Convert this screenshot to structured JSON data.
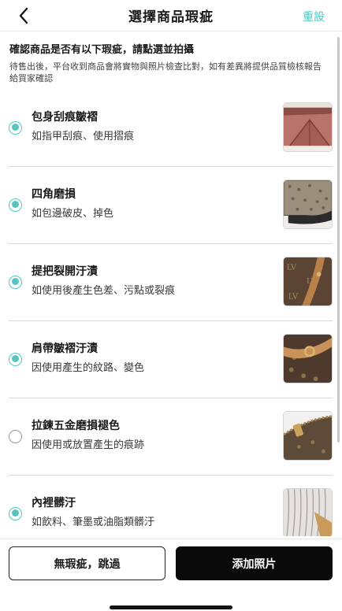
{
  "header": {
    "back_icon": "chevron-left-icon",
    "title": "選擇商品瑕疵",
    "reset_label": "重設",
    "accent_color": "#57c4bd"
  },
  "intro": {
    "title": "確認商品是否有以下瑕疵，請點選並拍攝",
    "desc": "待售出後，平台收到商品會將實物與照片檢查比對，如有差異將提供品質檢核報告給買家確認"
  },
  "defects": [
    {
      "title": "包身刮痕皺褶",
      "sub": "如指甲刮痕、使用摺痕",
      "selected": true
    },
    {
      "title": "四角磨損",
      "sub": "如包邊破皮、掉色",
      "selected": true
    },
    {
      "title": "提把裂開汙漬",
      "sub": "如使用後產生色差、污點或裂痕",
      "selected": true
    },
    {
      "title": "肩帶皺褶汙漬",
      "sub": "因使用產生的紋路、變色",
      "selected": true
    },
    {
      "title": "拉鍊五金磨損褪色",
      "sub": "因使用或放置產生的痕跡",
      "selected": false
    },
    {
      "title": "內裡髒汙",
      "sub": "如飲料、筆墨或油脂類髒汙",
      "selected": true
    }
  ],
  "footer": {
    "skip_label": "無瑕疵，跳過",
    "add_label": "添加照片"
  }
}
